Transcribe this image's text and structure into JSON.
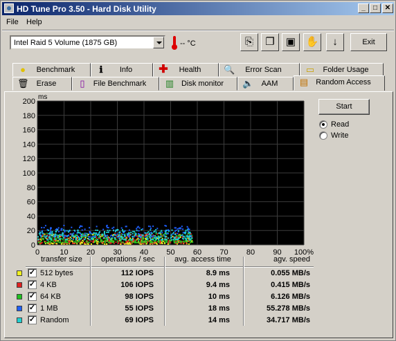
{
  "window": {
    "title": "HD Tune Pro 3.50 - Hard Disk Utility",
    "minimize_glyph": "_",
    "maximize_glyph": "□",
    "close_glyph": "✕"
  },
  "menu": {
    "file": "File",
    "help": "Help"
  },
  "drive_select": {
    "value": "Intel   Raid 5 Volume (1875 GB)"
  },
  "temperature": {
    "value": "-- °C",
    "icon": "thermometer-icon"
  },
  "toolbar": {
    "buttons": [
      {
        "icon": "copy-info-icon"
      },
      {
        "icon": "copy-screen-icon"
      },
      {
        "icon": "save-icon"
      },
      {
        "icon": "options-icon"
      },
      {
        "icon": "download-arrow-icon"
      }
    ],
    "exit_label": "Exit"
  },
  "tabs": {
    "row1": [
      {
        "label": "Benchmark",
        "icon": "benchmark-icon"
      },
      {
        "label": "Info",
        "icon": "info-icon"
      },
      {
        "label": "Health",
        "icon": "health-icon"
      },
      {
        "label": "Error Scan",
        "icon": "error-scan-icon"
      },
      {
        "label": "Folder Usage",
        "icon": "folder-icon"
      }
    ],
    "row2": [
      {
        "label": "Erase",
        "icon": "erase-icon"
      },
      {
        "label": "File Benchmark",
        "icon": "file-benchmark-icon"
      },
      {
        "label": "Disk monitor",
        "icon": "disk-monitor-icon"
      },
      {
        "label": "AAM",
        "icon": "speaker-icon"
      },
      {
        "label": "Random Access",
        "icon": "random-access-icon",
        "active": true
      }
    ]
  },
  "controls": {
    "start_label": "Start",
    "mode_options": [
      {
        "label": "Read",
        "selected": true
      },
      {
        "label": "Write",
        "selected": false
      }
    ]
  },
  "chart_data": {
    "type": "scatter",
    "ylabel": "ms",
    "ylim": [
      0,
      200
    ],
    "xlim": [
      0,
      100
    ],
    "y_ticks": [
      "200",
      "180",
      "160",
      "140",
      "120",
      "100",
      "80",
      "60",
      "40",
      "20",
      "0"
    ],
    "x_ticks": [
      "0",
      "10",
      "20",
      "30",
      "40",
      "50",
      "60",
      "70",
      "80",
      "90",
      "100%"
    ],
    "grid": true,
    "background": "#000000",
    "grid_color": "#3c3c3c",
    "series": [
      {
        "name": "512 bytes",
        "color": "#f0f020",
        "x_range": [
          0,
          58
        ],
        "y_range": [
          2,
          16
        ],
        "approx_points": 260
      },
      {
        "name": "4 KB",
        "color": "#e02020",
        "x_range": [
          0,
          58
        ],
        "y_range": [
          3,
          17
        ],
        "approx_points": 260
      },
      {
        "name": "64 KB",
        "color": "#20c020",
        "x_range": [
          0,
          58
        ],
        "y_range": [
          4,
          18
        ],
        "approx_points": 260
      },
      {
        "name": "1 MB",
        "color": "#2060ff",
        "x_range": [
          0,
          58
        ],
        "y_range": [
          12,
          28
        ],
        "approx_points": 200
      },
      {
        "name": "Random",
        "color": "#20d0d0",
        "x_range": [
          0,
          58
        ],
        "y_range": [
          8,
          22
        ],
        "approx_points": 260
      }
    ]
  },
  "results": {
    "headers": {
      "transfer_size": "transfer size",
      "ops": "operations / sec",
      "access": "avg. access time",
      "speed": "agv. speed"
    },
    "rows": [
      {
        "size": "512 bytes",
        "color": "#f0f020",
        "checked": true,
        "ops": "112 IOPS",
        "access": "8.9 ms",
        "speed": "0.055 MB/s"
      },
      {
        "size": "4 KB",
        "color": "#e02020",
        "checked": true,
        "ops": "106 IOPS",
        "access": "9.4 ms",
        "speed": "0.415 MB/s"
      },
      {
        "size": "64 KB",
        "color": "#20c020",
        "checked": true,
        "ops": "98 IOPS",
        "access": "10 ms",
        "speed": "6.126 MB/s"
      },
      {
        "size": "1 MB",
        "color": "#2060ff",
        "checked": true,
        "ops": "55 IOPS",
        "access": "18 ms",
        "speed": "55.278 MB/s"
      },
      {
        "size": "Random",
        "color": "#20d0d0",
        "checked": true,
        "ops": "69 IOPS",
        "access": "14 ms",
        "speed": "34.717 MB/s"
      }
    ]
  }
}
